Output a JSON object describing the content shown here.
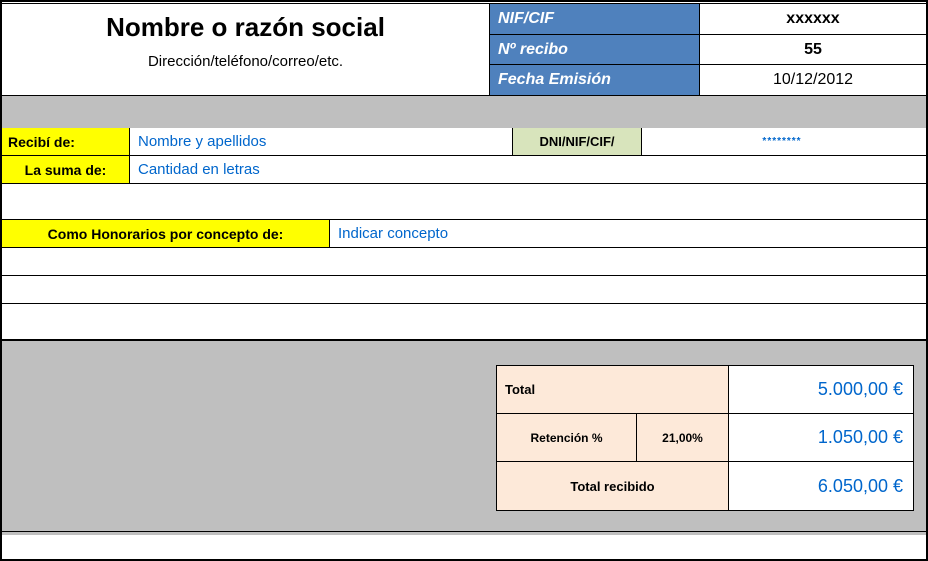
{
  "company": {
    "name": "Nombre o razón social",
    "subtitle": "Dirección/teléfono/correo/etc."
  },
  "meta": {
    "nif_label": "NIF/CIF",
    "nif_value": "xxxxxx",
    "recibo_label": "Nº  recibo",
    "recibo_value": "55",
    "fecha_label": "Fecha Emisión",
    "fecha_value": "10/12/2012"
  },
  "body": {
    "recibi_label": "Recibí de:",
    "recibi_value": "Nombre y apellidos",
    "dni_label": "DNI/NIF/CIF/",
    "dni_value": "********",
    "suma_label": "La suma de:",
    "suma_value": "Cantidad en letras",
    "concepto_label": "Como Honorarios por concepto de:",
    "concepto_value": "Indicar concepto"
  },
  "totals": {
    "total_label": "Total",
    "total_value": "5.000,00 €",
    "retencion_label": "Retención %",
    "retencion_pct": "21,00%",
    "retencion_value": "1.050,00 €",
    "recibido_label": "Total recibido",
    "recibido_value": "6.050,00 €"
  }
}
